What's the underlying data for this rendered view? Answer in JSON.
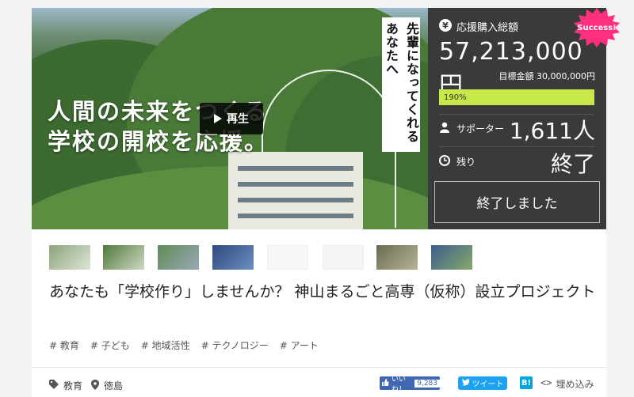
{
  "hero": {
    "line1": "人間の未来をつくる",
    "line2": "学校の開校を応援。",
    "vertical_col1": "先輩になってくれる",
    "vertical_col2": "あなたへ",
    "play_label": "再生"
  },
  "panel": {
    "yen_symbol": "¥",
    "total_label": "応援購入総額",
    "total_amount": "57,213,000円",
    "goal_text": "目標金額 30,000,000円",
    "progress_percent_label": "190%",
    "progress_percent": 190,
    "supporters_label": "サポーター",
    "supporters_value": "1,611人",
    "remaining_label": "残り",
    "remaining_value": "終了",
    "end_button": "終了しました"
  },
  "badge": {
    "label": "Success!",
    "color": "#ff2f7e"
  },
  "project": {
    "title": "あなたも「学校作り」しませんか？ 神山まるごと高専（仮称）設立プロジェクト",
    "tags": [
      "# 教育",
      "# 子ども",
      "# 地域活性",
      "# テクノロジー",
      "# アート"
    ]
  },
  "footer": {
    "category": "教育",
    "location": "徳島",
    "like_label": "いいね！",
    "like_count": "9,283",
    "tweet_label": "ツイート",
    "hatena_label": "B!",
    "embed_label": "埋め込み"
  },
  "colors": {
    "panel_bg": "#3a3a3a",
    "progress": "#c6e84a",
    "facebook": "#4267b2",
    "twitter": "#1da1f2",
    "hatena": "#00a4de"
  }
}
